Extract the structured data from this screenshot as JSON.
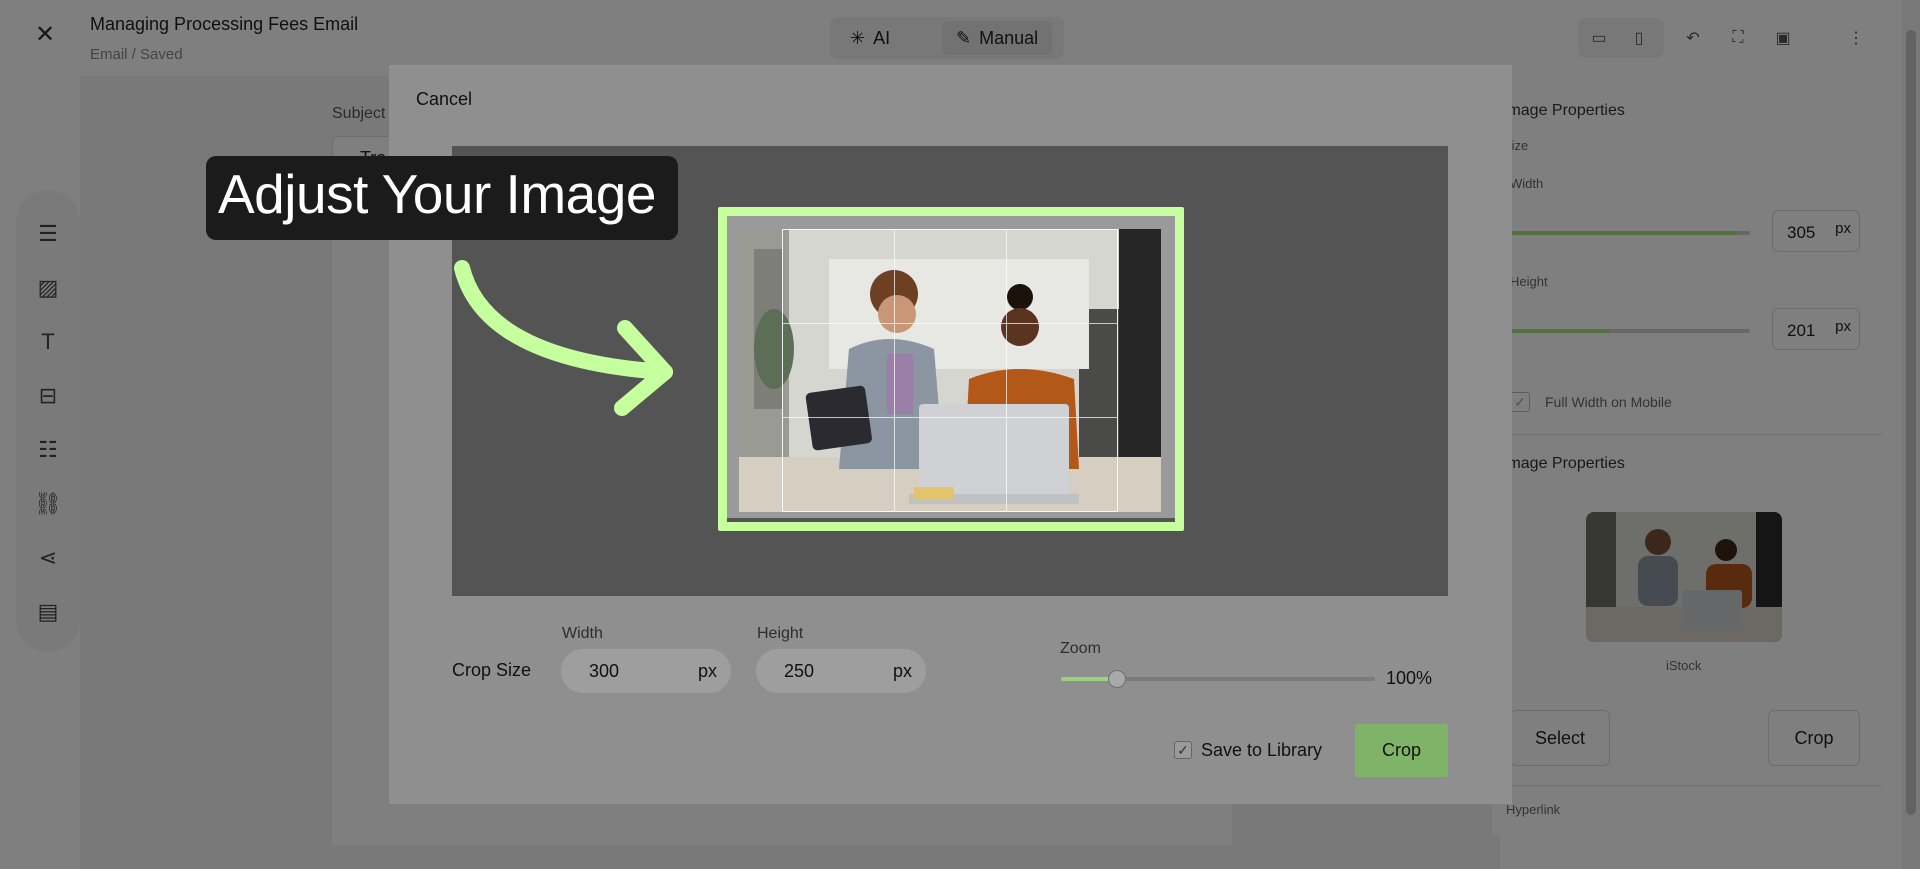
{
  "header": {
    "title": "Managing Processing Fees Email",
    "subtitle": "Email / Saved",
    "mode_ai": "AI",
    "mode_manual": "Manual"
  },
  "editor": {
    "subject_label": "Subject",
    "subject_value": "Tra"
  },
  "right_panel": {
    "section1_title": "Image Properties",
    "size_label": "Size",
    "width_label": "Width",
    "width_value": "305",
    "height_label": "Height",
    "height_value": "201",
    "unit": "px",
    "full_width_mobile": "Full Width on Mobile",
    "section2_title": "Image Properties",
    "thumb_caption": "iStock",
    "select_btn": "Select",
    "crop_btn": "Crop",
    "hyperlink": "Hyperlink"
  },
  "callout": {
    "text": "Adjust Your Image",
    "color": "#c6ff9e"
  },
  "modal": {
    "cancel": "Cancel",
    "crop_size_label": "Crop Size",
    "width_label": "Width",
    "width_value": "300",
    "height_label": "Height",
    "height_value": "250",
    "unit": "px",
    "zoom_label": "Zoom",
    "zoom_value": "100%",
    "zoom_level": 0.17,
    "save_to_library": "Save to Library",
    "save_checked": true,
    "crop_button": "Crop"
  },
  "colors": {
    "accent_green": "#a6e07f",
    "highlight": "#c6ff9e"
  }
}
